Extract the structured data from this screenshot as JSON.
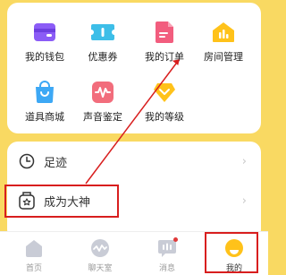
{
  "grid": {
    "wallet_label": "我的钱包",
    "coupons_label": "优惠券",
    "orders_label": "我的订单",
    "room_mgmt_label": "房间管理",
    "props_store_label": "道具商城",
    "voice_label": "声音鉴定",
    "level_label": "我的等级"
  },
  "list": {
    "footprint_label": "足迹",
    "become_god_label": "成为大神",
    "chevron": "›"
  },
  "tabbar": {
    "home_label": "首页",
    "chatroom_label": "聊天室",
    "messages_label": "消息",
    "mine_label": "我的"
  },
  "colors": {
    "background": "#F9D962",
    "annotation": "#D81E1E",
    "wallet": "#8B5CF6",
    "coupons": "#3DBEE8",
    "orders": "#F25D7E",
    "room_mgmt": "#FFC21A",
    "props_store": "#3DA8F5",
    "voice": "#F26D7C",
    "level": "#FFC21A"
  }
}
